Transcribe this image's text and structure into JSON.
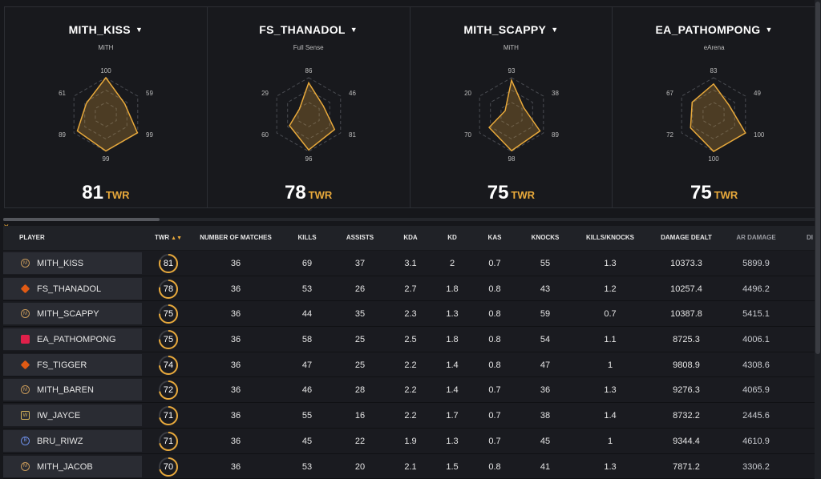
{
  "compare_cards": [
    {
      "name": "MITH_KISS",
      "team": "MiTH",
      "top": "100",
      "right_top": "59",
      "right_bottom": "99",
      "bottom": "99",
      "left_bottom": "89",
      "left_top": "61",
      "twr_value": "81",
      "twr_label": "TWR",
      "stats": [
        100,
        59,
        99,
        99,
        89,
        61
      ]
    },
    {
      "name": "FS_THANADOL",
      "team": "Full Sense",
      "top": "86",
      "right_top": "46",
      "right_bottom": "81",
      "bottom": "96",
      "left_bottom": "60",
      "left_top": "29",
      "twr_value": "78",
      "twr_label": "TWR",
      "stats": [
        86,
        46,
        81,
        96,
        60,
        29
      ]
    },
    {
      "name": "MITH_SCAPPY",
      "team": "MiTH",
      "top": "93",
      "right_top": "38",
      "right_bottom": "89",
      "bottom": "98",
      "left_bottom": "70",
      "left_top": "20",
      "twr_value": "75",
      "twr_label": "TWR",
      "stats": [
        93,
        38,
        89,
        98,
        70,
        20
      ]
    },
    {
      "name": "EA_PATHOMPONG",
      "team": "eArena",
      "top": "83",
      "right_top": "49",
      "right_bottom": "100",
      "bottom": "100",
      "left_bottom": "72",
      "left_top": "67",
      "twr_value": "75",
      "twr_label": "TWR",
      "stats": [
        83,
        49,
        100,
        100,
        72,
        67
      ]
    }
  ],
  "table": {
    "headers": {
      "player": "PLAYER",
      "twr": "TWR",
      "matches": "NUMBER OF MATCHES",
      "kills": "KILLS",
      "assists": "ASSISTS",
      "kda": "KDA",
      "kd": "KD",
      "kas": "KAS",
      "knocks": "KNOCKS",
      "kills_knocks": "KILLS/KNOCKS",
      "damage": "DAMAGE DEALT",
      "ar_damage": "AR DAMAGE",
      "cut": "DI"
    },
    "sort_icon": "▲▼",
    "rows": [
      {
        "team": "mith",
        "logo": "M",
        "player": "MITH_KISS",
        "twr": "81",
        "twr_pct": 0.81,
        "matches": "36",
        "kills": "69",
        "assists": "37",
        "kda": "3.1",
        "kd": "2",
        "kas": "0.7",
        "knocks": "55",
        "kills_knocks": "1.3",
        "damage": "10373.3",
        "ar_damage": "5899.9"
      },
      {
        "team": "fs",
        "logo": "",
        "player": "FS_THANADOL",
        "twr": "78",
        "twr_pct": 0.78,
        "matches": "36",
        "kills": "53",
        "assists": "26",
        "kda": "2.7",
        "kd": "1.8",
        "kas": "0.8",
        "knocks": "43",
        "kills_knocks": "1.2",
        "damage": "10257.4",
        "ar_damage": "4496.2"
      },
      {
        "team": "mith",
        "logo": "M",
        "player": "MITH_SCAPPY",
        "twr": "75",
        "twr_pct": 0.75,
        "matches": "36",
        "kills": "44",
        "assists": "35",
        "kda": "2.3",
        "kd": "1.3",
        "kas": "0.8",
        "knocks": "59",
        "kills_knocks": "0.7",
        "damage": "10387.8",
        "ar_damage": "5415.1"
      },
      {
        "team": "ea",
        "logo": "",
        "player": "EA_PATHOMPONG",
        "twr": "75",
        "twr_pct": 0.75,
        "matches": "36",
        "kills": "58",
        "assists": "25",
        "kda": "2.5",
        "kd": "1.8",
        "kas": "0.8",
        "knocks": "54",
        "kills_knocks": "1.1",
        "damage": "8725.3",
        "ar_damage": "4006.1"
      },
      {
        "team": "fs",
        "logo": "",
        "player": "FS_TIGGER",
        "twr": "74",
        "twr_pct": 0.74,
        "matches": "36",
        "kills": "47",
        "assists": "25",
        "kda": "2.2",
        "kd": "1.4",
        "kas": "0.8",
        "knocks": "47",
        "kills_knocks": "1",
        "damage": "9808.9",
        "ar_damage": "4308.6"
      },
      {
        "team": "mith",
        "logo": "M",
        "player": "MITH_BAREN",
        "twr": "72",
        "twr_pct": 0.72,
        "matches": "36",
        "kills": "46",
        "assists": "28",
        "kda": "2.2",
        "kd": "1.4",
        "kas": "0.7",
        "knocks": "36",
        "kills_knocks": "1.3",
        "damage": "9276.3",
        "ar_damage": "4065.9"
      },
      {
        "team": "iw",
        "logo": "W",
        "player": "IW_JAYCE",
        "twr": "71",
        "twr_pct": 0.71,
        "matches": "36",
        "kills": "55",
        "assists": "16",
        "kda": "2.2",
        "kd": "1.7",
        "kas": "0.7",
        "knocks": "38",
        "kills_knocks": "1.4",
        "damage": "8732.2",
        "ar_damage": "2445.6"
      },
      {
        "team": "bru",
        "logo": "B",
        "player": "BRU_RIWZ",
        "twr": "71",
        "twr_pct": 0.71,
        "matches": "36",
        "kills": "45",
        "assists": "22",
        "kda": "1.9",
        "kd": "1.3",
        "kas": "0.7",
        "knocks": "45",
        "kills_knocks": "1",
        "damage": "9344.4",
        "ar_damage": "4610.9"
      },
      {
        "team": "mith",
        "logo": "M",
        "player": "MITH_JACOB",
        "twr": "70",
        "twr_pct": 0.7,
        "matches": "36",
        "kills": "53",
        "assists": "20",
        "kda": "2.1",
        "kd": "1.5",
        "kas": "0.8",
        "knocks": "41",
        "kills_knocks": "1.3",
        "damage": "7871.2",
        "ar_damage": "3306.2"
      }
    ]
  },
  "colors": {
    "accent": "#e8a93b",
    "radar_fill": "rgba(232,169,59,0.25)",
    "grid": "#4a4c52"
  }
}
